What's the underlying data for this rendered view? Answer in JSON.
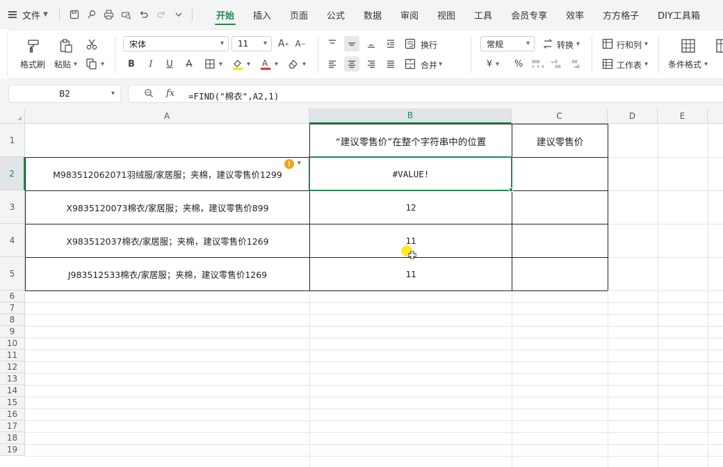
{
  "menu": {
    "file_label": "文件",
    "tabs": [
      {
        "label": "开始",
        "active": true
      },
      {
        "label": "插入",
        "active": false
      },
      {
        "label": "页面",
        "active": false
      },
      {
        "label": "公式",
        "active": false
      },
      {
        "label": "数据",
        "active": false
      },
      {
        "label": "审阅",
        "active": false
      },
      {
        "label": "视图",
        "active": false
      },
      {
        "label": "工具",
        "active": false
      },
      {
        "label": "会员专享",
        "active": false
      },
      {
        "label": "效率",
        "active": false
      },
      {
        "label": "方方格子",
        "active": false
      },
      {
        "label": "DIY工具箱",
        "active": false
      }
    ]
  },
  "ribbon": {
    "format_painter": "格式刷",
    "paste": "粘贴",
    "font_name": "宋体",
    "font_size": "11",
    "bold": "B",
    "italic": "I",
    "underline": "U",
    "strikethrough": "A",
    "wrap_text": "换行",
    "merge": "合并",
    "number_format": "常规",
    "convert": "转换",
    "rows_cols": "行和列",
    "worksheet": "工作表",
    "conditional_format": "条件格式",
    "currency_symbol": "¥",
    "percent_symbol": "%"
  },
  "formula_bar": {
    "name_box": "B2",
    "fx_label": "fx",
    "formula": "=FIND(\"棉衣\",A2,1)"
  },
  "sheet": {
    "columns": [
      "A",
      "B",
      "C",
      "D",
      "E"
    ],
    "rows": [
      "1",
      "2",
      "3",
      "4",
      "5",
      "6",
      "7",
      "8",
      "9",
      "10",
      "11",
      "12",
      "13",
      "14",
      "15",
      "16",
      "17",
      "18",
      "19"
    ],
    "header": {
      "b1": "“建议零售价”在整个字符串中的位置",
      "c1": "建议零售价"
    },
    "data": [
      {
        "a": "M983512062071羽绒服/家居服；夹棉，建议零售价1299",
        "b": "#VALUE!"
      },
      {
        "a": "X9835120073棉衣/家居服；夹棉，建议零售价899",
        "b": "12"
      },
      {
        "a": "X983512037棉衣/家居服；夹棉，建议零售价1269",
        "b": "11"
      },
      {
        "a": "J983512533棉衣/家居服；夹棉，建议零售价1269",
        "b": "11"
      }
    ],
    "selected_cell": "B2",
    "accent_color": "#1e8a4e"
  }
}
